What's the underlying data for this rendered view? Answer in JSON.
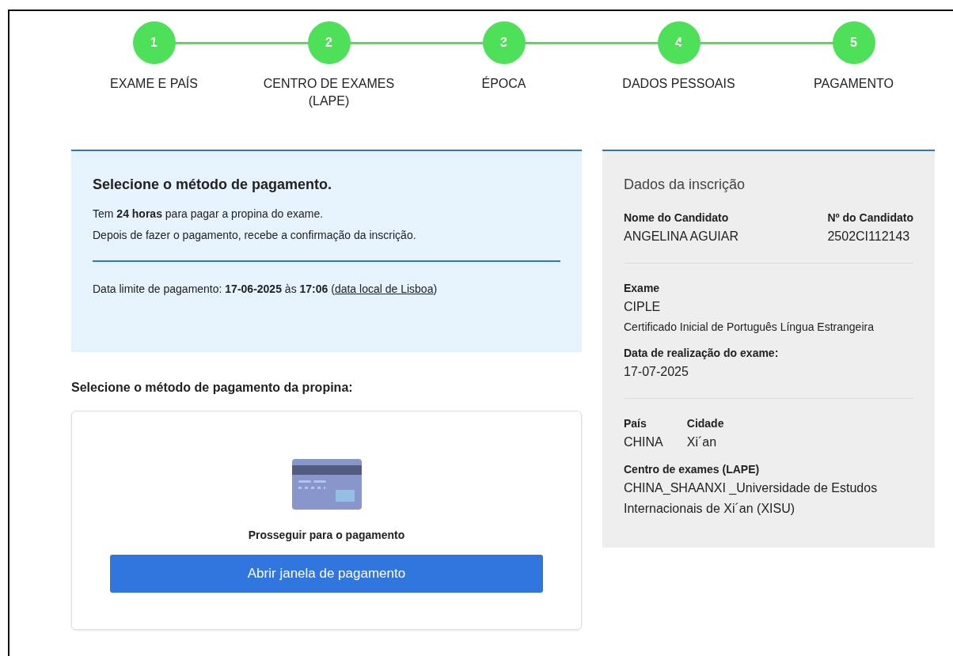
{
  "steps": [
    {
      "number": "1",
      "label": "EXAME E PAÍS",
      "completed": true
    },
    {
      "number": "2",
      "label": "CENTRO DE EXAMES (LAPE)",
      "completed": true
    },
    {
      "number": "3",
      "label": "ÉPOCA",
      "completed": true
    },
    {
      "number": "4",
      "label": "DADOS PESSOAIS",
      "completed": true
    },
    {
      "number": "5",
      "label": "PAGAMENTO",
      "completed": true
    }
  ],
  "notice": {
    "title": "Selecione o método de pagamento.",
    "lines": [
      "Tem **24 horas** para pagar a propina do exame.",
      "Depois de fazer o pagamento, recebe a confirmação da inscrição."
    ],
    "deadline": {
      "text": "Data limite de pagamento: **17-06-2025** às **17:06** (",
      "link": "data local de Lisboa",
      "after": ")"
    }
  },
  "payment": {
    "heading": "Selecione o método de pagamento da propina:",
    "caption": "Prosseguir para o pagamento",
    "button": "Abrir janela de pagamento"
  },
  "summary": {
    "title": "Dados da inscrição",
    "sections": [
      {
        "rows": [
          [
            {
              "label": "Nome do Candidato",
              "value": "ANGELINA AGUIAR"
            },
            {
              "label": "Nº do Candidato",
              "value": "2502CI112143"
            }
          ]
        ]
      },
      {
        "rows": [
          [
            {
              "label": "Exame",
              "value": "CIPLE",
              "note": "Certificado Inicial de Português Língua Estrangeira"
            }
          ],
          [
            {
              "label": "Data de realização do exame:",
              "value": "17-07-2025"
            }
          ]
        ]
      },
      {
        "rows": [
          [
            {
              "label": "País",
              "value": "CHINA"
            },
            {
              "label": "Cidade",
              "value": "Xi´an"
            }
          ],
          [
            {
              "label": "Centro de exames (LAPE)",
              "value": "CHINA_SHAANXI _Universidade de Estudos Internacionais de Xi´an (XISU)"
            }
          ]
        ]
      }
    ]
  }
}
